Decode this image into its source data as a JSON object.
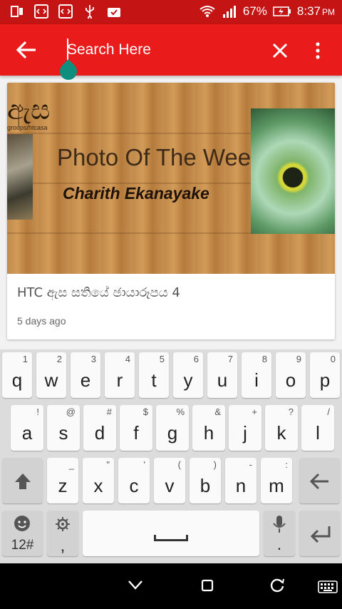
{
  "status_bar": {
    "battery": "67%",
    "time": "8:37",
    "ampm": "PM"
  },
  "search": {
    "placeholder": "Search Here",
    "value": ""
  },
  "card": {
    "image_sinhala": "ඇස",
    "image_url": "groups/htcasa",
    "image_title": "Photo Of The Week",
    "image_subtitle": "Charith Ekanayake",
    "title": "HTC ඇස සතියේ ඡායාරූපය 4",
    "time": "5 days ago"
  },
  "keyboard": {
    "row1": [
      {
        "k": "q",
        "h": "1"
      },
      {
        "k": "w",
        "h": "2"
      },
      {
        "k": "e",
        "h": "3"
      },
      {
        "k": "r",
        "h": "4"
      },
      {
        "k": "t",
        "h": "5"
      },
      {
        "k": "y",
        "h": "6"
      },
      {
        "k": "u",
        "h": "7"
      },
      {
        "k": "i",
        "h": "8"
      },
      {
        "k": "o",
        "h": "9"
      },
      {
        "k": "p",
        "h": "0"
      }
    ],
    "row2": [
      {
        "k": "a",
        "h": "!"
      },
      {
        "k": "s",
        "h": "@"
      },
      {
        "k": "d",
        "h": "#"
      },
      {
        "k": "f",
        "h": "$"
      },
      {
        "k": "g",
        "h": "%"
      },
      {
        "k": "h",
        "h": "&"
      },
      {
        "k": "j",
        "h": "+"
      },
      {
        "k": "k",
        "h": "?"
      },
      {
        "k": "l",
        "h": "/"
      }
    ],
    "row3": [
      {
        "k": "z",
        "h": "_"
      },
      {
        "k": "x",
        "h": "\""
      },
      {
        "k": "c",
        "h": "'"
      },
      {
        "k": "v",
        "h": "("
      },
      {
        "k": "b",
        "h": ")"
      },
      {
        "k": "n",
        "h": "-"
      },
      {
        "k": "m",
        "h": ":"
      }
    ],
    "symbols_label": "12#",
    "comma": ",",
    "period": "."
  },
  "icons": [
    "arrow-left-icon",
    "close-icon",
    "more-vert-icon",
    "shift-icon",
    "backspace-icon",
    "emoji-icon",
    "settings-icon",
    "mic-icon",
    "enter-icon",
    "nav-back-icon",
    "nav-home-icon",
    "nav-recents-icon",
    "keyboard-icon"
  ],
  "colors": {
    "status_bar": "#c41414",
    "app_bar": "#e91b1b",
    "cursor_handle": "#0e8e7d"
  }
}
